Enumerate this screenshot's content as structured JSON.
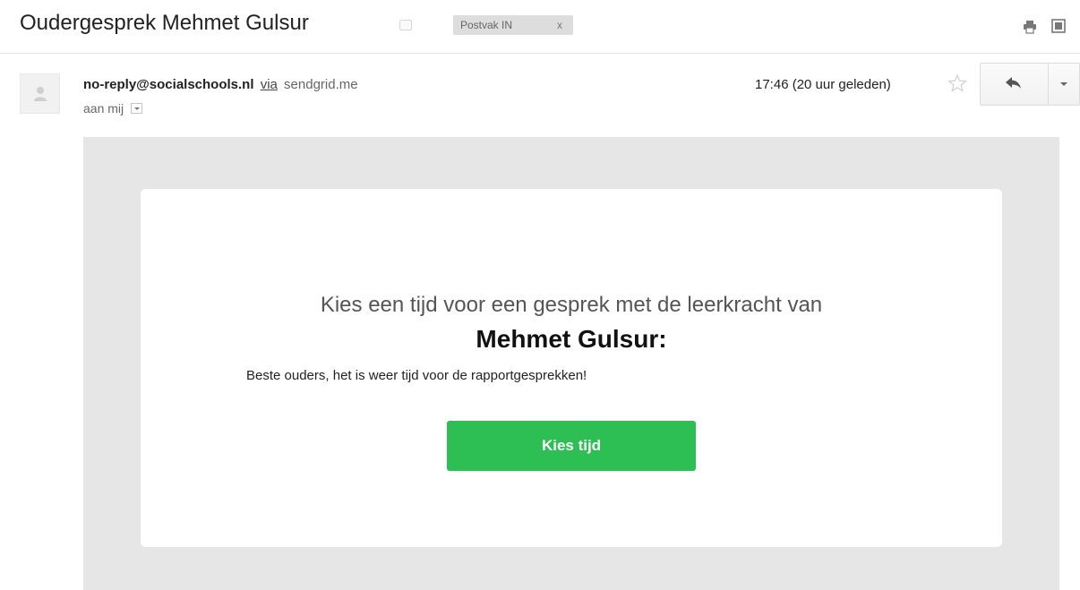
{
  "thread": {
    "subject": "Oudergesprek Mehmet Gulsur",
    "label": "Postvak IN",
    "label_close": "x",
    "actions": {
      "print_icon": "print-icon",
      "new_window_icon": "new-window-icon"
    }
  },
  "message": {
    "sender": "no-reply@socialschools.nl",
    "via_label": "via",
    "via_domain": "sendgrid.me",
    "to": "aan mij",
    "timestamp": "17:46 (20 uur geleden)",
    "icons": {
      "avatar": "person-icon",
      "star": "star-icon",
      "reply": "reply-icon",
      "more": "chevron-down-icon"
    }
  },
  "email": {
    "heading": "Kies een tijd voor een gesprek met de leerkracht van",
    "child_name": "Mehmet Gulsur:",
    "body": "Beste ouders, het is weer tijd voor de rapportgesprekken!",
    "cta_label": "Kies tijd",
    "colors": {
      "cta_background": "#2dbe54",
      "frame_background": "#e6e6e6"
    }
  }
}
